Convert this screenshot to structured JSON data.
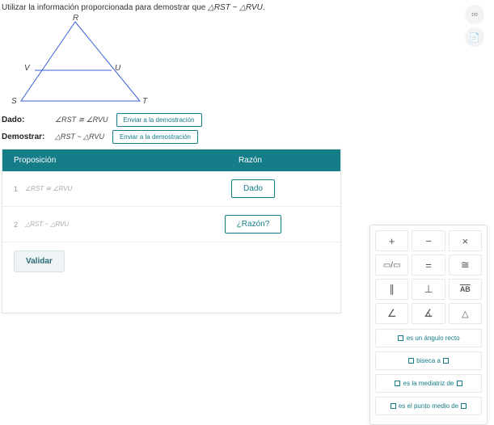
{
  "prompt": {
    "text_pre": "Utilizar la información proporcionada para demostrar que ",
    "tri1": "△RST",
    "sim": " ~ ",
    "tri2": "△RVU",
    "text_post": "."
  },
  "labels": {
    "R": "R",
    "V": "V",
    "U": "U",
    "S": "S",
    "T": "T"
  },
  "given": {
    "label": "Dado:",
    "expr": "∠RST ≅ ∠RVU",
    "button": "Enviar a la demostración"
  },
  "prove": {
    "label": "Demostrar:",
    "expr": "△RST ~ △RVU",
    "button": "Enviar a la demostración"
  },
  "table": {
    "head_prop": "Proposición",
    "head_reason": "Razón",
    "rows": [
      {
        "n": "1",
        "stmt": "∠RST ≅ ∠RVU",
        "reason": "Dado"
      },
      {
        "n": "2",
        "stmt": "△RST ~ △RVU",
        "reason": "¿Razón?"
      }
    ],
    "validate": "Validar"
  },
  "palette": {
    "cells": [
      "+",
      "−",
      "×",
      "▭/▭",
      "=",
      "≅",
      "∥",
      "⊥",
      "AB",
      "∠",
      "∡",
      "△"
    ],
    "stmts": [
      "es un ángulo recto",
      "biseca a",
      "es la mediatriz de",
      "es el punto medio de"
    ]
  },
  "icons": {
    "link": "∞",
    "doc": "📄"
  }
}
